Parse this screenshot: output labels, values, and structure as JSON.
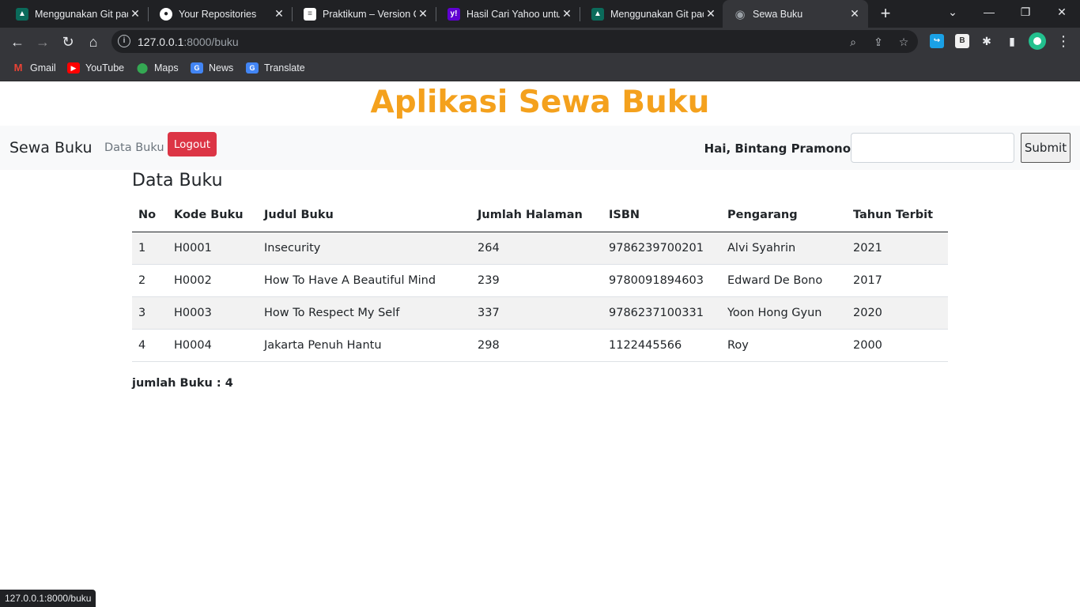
{
  "browser": {
    "tabs": [
      {
        "title": "Menggunakan Git pada",
        "favicon": "hat-icon",
        "color": "#0b6b5b"
      },
      {
        "title": "Your Repositories",
        "favicon": "github-icon",
        "color": "#ffffff"
      },
      {
        "title": "Praktikum – Version C",
        "favicon": "document-icon",
        "color": "#ffffff"
      },
      {
        "title": "Hasil Cari Yahoo untuk",
        "favicon": "yahoo-icon",
        "color": "#6001d2"
      },
      {
        "title": "Menggunakan Git pada",
        "favicon": "hat-icon",
        "color": "#0b6b5b"
      },
      {
        "title": "Sewa Buku",
        "favicon": "globe-icon",
        "color": "#9aa0a6"
      }
    ],
    "url_host": "127.0.0.1",
    "url_path": ":8000/buku",
    "bookmarks": [
      {
        "label": "Gmail",
        "icon": "gmail-icon"
      },
      {
        "label": "YouTube",
        "icon": "youtube-icon"
      },
      {
        "label": "Maps",
        "icon": "maps-icon"
      },
      {
        "label": "News",
        "icon": "news-icon"
      },
      {
        "label": "Translate",
        "icon": "translate-icon"
      }
    ],
    "status_url": "127.0.0.1:8000/buku"
  },
  "page": {
    "app_title": "Aplikasi Sewa Buku",
    "brand": "Sewa Buku",
    "nav_link": "Data Buku",
    "logout_label": "Logout",
    "greeting": "Hai, Bintang Pramono",
    "search_value": "",
    "submit_label": "Submit",
    "section_title": "Data Buku",
    "total_label": "jumlah Buku : 4"
  },
  "table": {
    "headers": [
      "No",
      "Kode Buku",
      "Judul Buku",
      "Jumlah Halaman",
      "ISBN",
      "Pengarang",
      "Tahun Terbit"
    ],
    "rows": [
      [
        "1",
        "H0001",
        "Insecurity",
        "264",
        "9786239700201",
        "Alvi Syahrin",
        "2021"
      ],
      [
        "2",
        "H0002",
        "How To Have A Beautiful Mind",
        "239",
        "9780091894603",
        "Edward De Bono",
        "2017"
      ],
      [
        "3",
        "H0003",
        "How To Respect My Self",
        "337",
        "9786237100331",
        "Yoon Hong Gyun",
        "2020"
      ],
      [
        "4",
        "H0004",
        "Jakarta Penuh Hantu",
        "298",
        "1122445566",
        "Roy",
        "2000"
      ]
    ]
  },
  "colors": {
    "title_orange": "#f4a11d",
    "logout_red": "#dc3545",
    "navbar_bg": "#f8f9fa"
  }
}
